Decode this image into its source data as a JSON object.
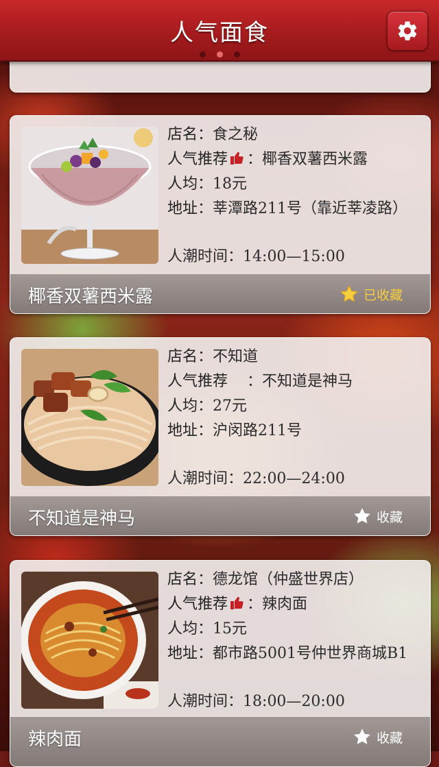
{
  "header": {
    "title": "人气面食",
    "page_dots": 3,
    "active_dot": 1,
    "settings_icon": "gear-icon"
  },
  "colors": {
    "header_red": "#b32024",
    "favorite_gold": "#f6cd3e"
  },
  "cards": [
    {
      "shop_label": "店名",
      "shop": "食之秘",
      "recommend_label": "人气推荐",
      "recommend": "椰香双薯西米露",
      "avg_label": "人均",
      "avg": "18元",
      "address_label": "地址",
      "address": "莘潭路211号（靠近莘凌路）",
      "time_label": "人潮时间",
      "time": "14:00—15:00",
      "footer_name": "椰香双薯西米露",
      "favorite_label": "已收藏",
      "favorited": true,
      "photo": "dessert-photo"
    },
    {
      "shop_label": "店名",
      "shop": "不知道",
      "recommend_label": "人气推荐",
      "recommend": "不知道是神马",
      "avg_label": "人均",
      "avg": "27元",
      "address_label": "地址",
      "address": "沪闵路211号",
      "time_label": "人潮时间",
      "time": "22:00—24:00",
      "footer_name": "不知道是神马",
      "favorite_label": "收藏",
      "favorited": false,
      "photo": "beef-noodle-photo"
    },
    {
      "shop_label": "店名",
      "shop": "德龙馆（仲盛世界店）",
      "recommend_label": "人气推荐",
      "recommend": "辣肉面",
      "avg_label": "人均",
      "avg": "15元",
      "address_label": "地址",
      "address": "都市路5001号仲世界商城B1",
      "time_label": "人潮时间",
      "time": "18:00—20:00",
      "footer_name": "辣肉面",
      "favorite_label": "收藏",
      "favorited": false,
      "photo": "spicy-noodle-photo"
    }
  ]
}
